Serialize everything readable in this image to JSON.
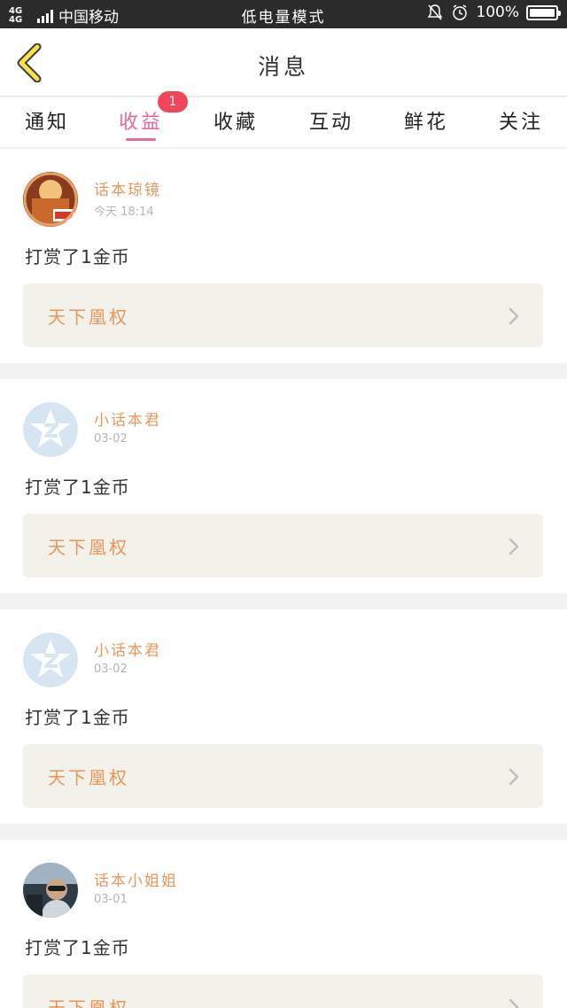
{
  "status_bar": {
    "network": "4G 4G",
    "carrier": "中国移动",
    "mode": "低电量模式",
    "battery": "100%"
  },
  "header": {
    "title": "消息"
  },
  "tabs": [
    {
      "label": "通知"
    },
    {
      "label": "收益",
      "badge": "1",
      "active": true
    },
    {
      "label": "收藏"
    },
    {
      "label": "互动"
    },
    {
      "label": "鲜花"
    },
    {
      "label": "关注"
    }
  ],
  "messages": [
    {
      "name": "话本琼镜",
      "time": "今天 18:14",
      "text": "打赏了1金币",
      "book": "天下凰权",
      "avatar": "profile-photo"
    },
    {
      "name": "小话本君",
      "time": "03-02",
      "text": "打赏了1金币",
      "book": "天下凰权",
      "avatar": "default-qq-avatar"
    },
    {
      "name": "小话本君",
      "time": "03-02",
      "text": "打赏了1金币",
      "book": "天下凰权",
      "avatar": "default-qq-avatar"
    },
    {
      "name": "话本小姐姐",
      "time": "03-01",
      "text": "打赏了1金币",
      "book": "天下凰权",
      "avatar": "profile-photo"
    }
  ],
  "colors": {
    "accent": "#e8699a",
    "name": "#e9965a",
    "badge": "#f0455a",
    "link_bg": "#f3f2ea"
  }
}
